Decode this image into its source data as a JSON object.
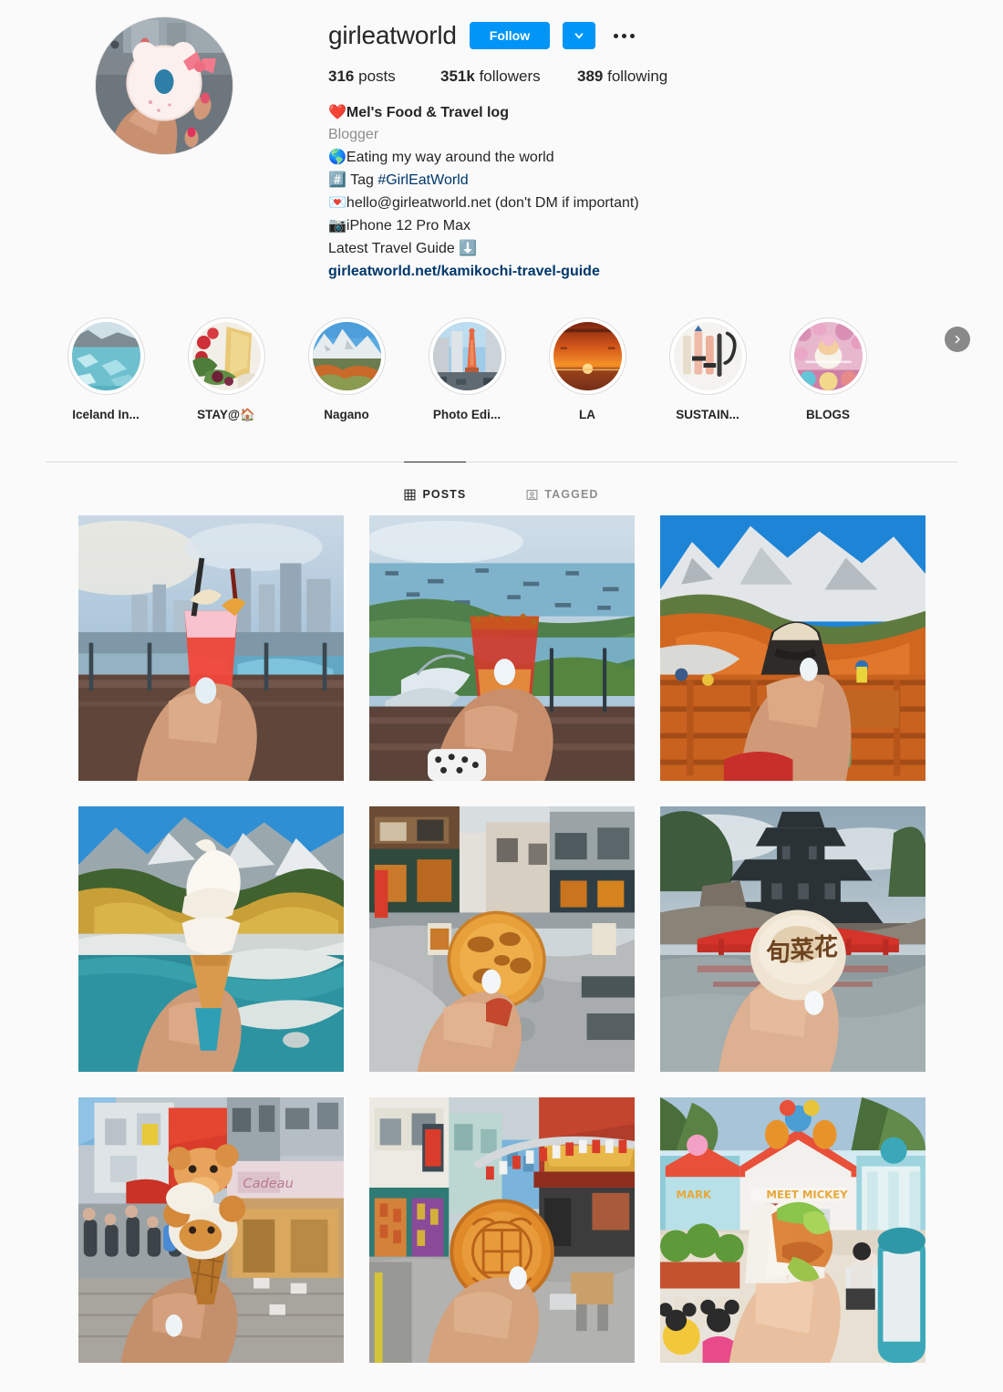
{
  "profile": {
    "username": "girleatworld",
    "follow_label": "Follow",
    "chevron_icon": "chevron-down-icon",
    "options_icon": "more-options-icon",
    "avatar_alt": "hand holding hello kitty donut",
    "stats": [
      {
        "value": "316",
        "label": "posts"
      },
      {
        "value": "351k",
        "label": "followers"
      },
      {
        "value": "389",
        "label": "following"
      }
    ],
    "bio": {
      "title": "Mel's Food & Travel log",
      "title_emoji": "❤️",
      "category": "Blogger",
      "lines": [
        {
          "emoji": "🌎",
          "text": "Eating my way around the world"
        },
        {
          "emoji": "#️⃣",
          "text": " Tag ",
          "link": "#GirlEatWorld"
        },
        {
          "emoji": "💌",
          "text": "hello@girleatworld.net (don't DM if important)"
        },
        {
          "emoji": "📷",
          "text": "iPhone 12 Pro Max"
        },
        {
          "emoji": "",
          "text": "Latest Travel Guide ",
          "trailing_emoji": "⬇️"
        }
      ],
      "url": "girleatworld.net/kamikochi-travel-guide"
    }
  },
  "highlights": {
    "next_icon": "chevron-right-icon",
    "items": [
      {
        "label": "Iceland In...",
        "theme": "iceland"
      },
      {
        "label": "STAY@🏠",
        "theme": "stay"
      },
      {
        "label": "Nagano",
        "theme": "nagano"
      },
      {
        "label": "Photo Edi...",
        "theme": "photoedit"
      },
      {
        "label": "LA",
        "theme": "la"
      },
      {
        "label": "SUSTAIN...",
        "theme": "sustain"
      },
      {
        "label": "BLOGS",
        "theme": "blogs"
      }
    ]
  },
  "tabs": [
    {
      "label": "POSTS",
      "icon": "grid-icon",
      "active": true
    },
    {
      "label": "TAGGED",
      "icon": "tagged-person-icon",
      "active": false
    }
  ],
  "grid": {
    "posts": [
      {
        "theme": "singapore-cocktail-skyline",
        "alt": "red cocktail held above Singapore city skyline at dusk"
      },
      {
        "theme": "gardens-bay-cocktail",
        "alt": "red rimmed cocktail above Gardens by the Bay and harbour"
      },
      {
        "theme": "onigiri-mountains",
        "alt": "onigiri rice ball held before autumn alpine mountains"
      },
      {
        "theme": "softserve-kamikochi",
        "alt": "soft serve ice cream cone at Kamikochi river valley"
      },
      {
        "theme": "senbei-street",
        "alt": "senbei rice cracker on a Japanese shopping street"
      },
      {
        "theme": "manju-castle",
        "alt": "manju bun with kanji before Matsumoto Castle and red bridge"
      },
      {
        "theme": "bear-icecream-harajuku",
        "alt": "teddy bear ice cream cone on a busy Harajuku street"
      },
      {
        "theme": "mooncake-chinatown",
        "alt": "mooncake held in decorated Chinatown street"
      },
      {
        "theme": "mickey-hotdog-disney",
        "alt": "Mickey glove hot dog at Disneyland Toontown"
      }
    ]
  },
  "colors": {
    "accent": "#0095f6",
    "link": "#00376b",
    "muted": "#8e8e8e",
    "text": "#262626",
    "background": "#fafafa",
    "border": "#dbdbdb"
  }
}
